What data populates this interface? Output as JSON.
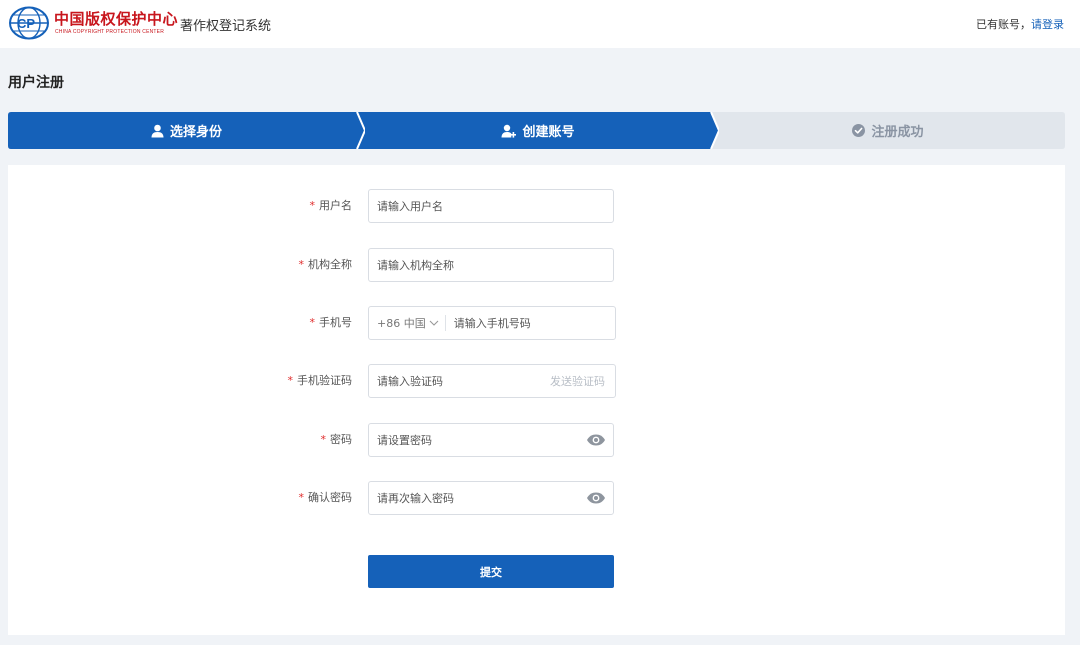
{
  "header": {
    "logo_cn": "中国版权保护中心",
    "logo_en": "CHINA COPYRIGHT PROTECTION CENTER",
    "app_title": "著作权登记系统",
    "account_question": "已有账号，",
    "login_link": "请登录"
  },
  "page_title": "用户注册",
  "steps": [
    {
      "label": "选择身份",
      "icon": "user-icon",
      "state": "done"
    },
    {
      "label": "创建账号",
      "icon": "user-add-icon",
      "state": "active"
    },
    {
      "label": "注册成功",
      "icon": "check-circle-icon",
      "state": "pending"
    }
  ],
  "form": {
    "username": {
      "label": "用户名",
      "placeholder": "请输入用户名"
    },
    "org_name": {
      "label": "机构全称",
      "placeholder": "请输入机构全称"
    },
    "phone": {
      "label": "手机号",
      "country_code": "+86 中国",
      "placeholder": "请输入手机号码"
    },
    "sms_code": {
      "label": "手机验证码",
      "placeholder": "请输入验证码",
      "send_label": "发送验证码"
    },
    "password": {
      "label": "密码",
      "placeholder": "请设置密码"
    },
    "confirm_password": {
      "label": "确认密码",
      "placeholder": "请再次输入密码"
    },
    "required_mark": "*",
    "submit_label": "提交"
  },
  "colors": {
    "primary": "#1561b9",
    "required": "#e02b2b",
    "brand_red": "#c8161d",
    "step_pending_bg": "#e1e6ec",
    "page_bg": "#f0f3f7"
  }
}
